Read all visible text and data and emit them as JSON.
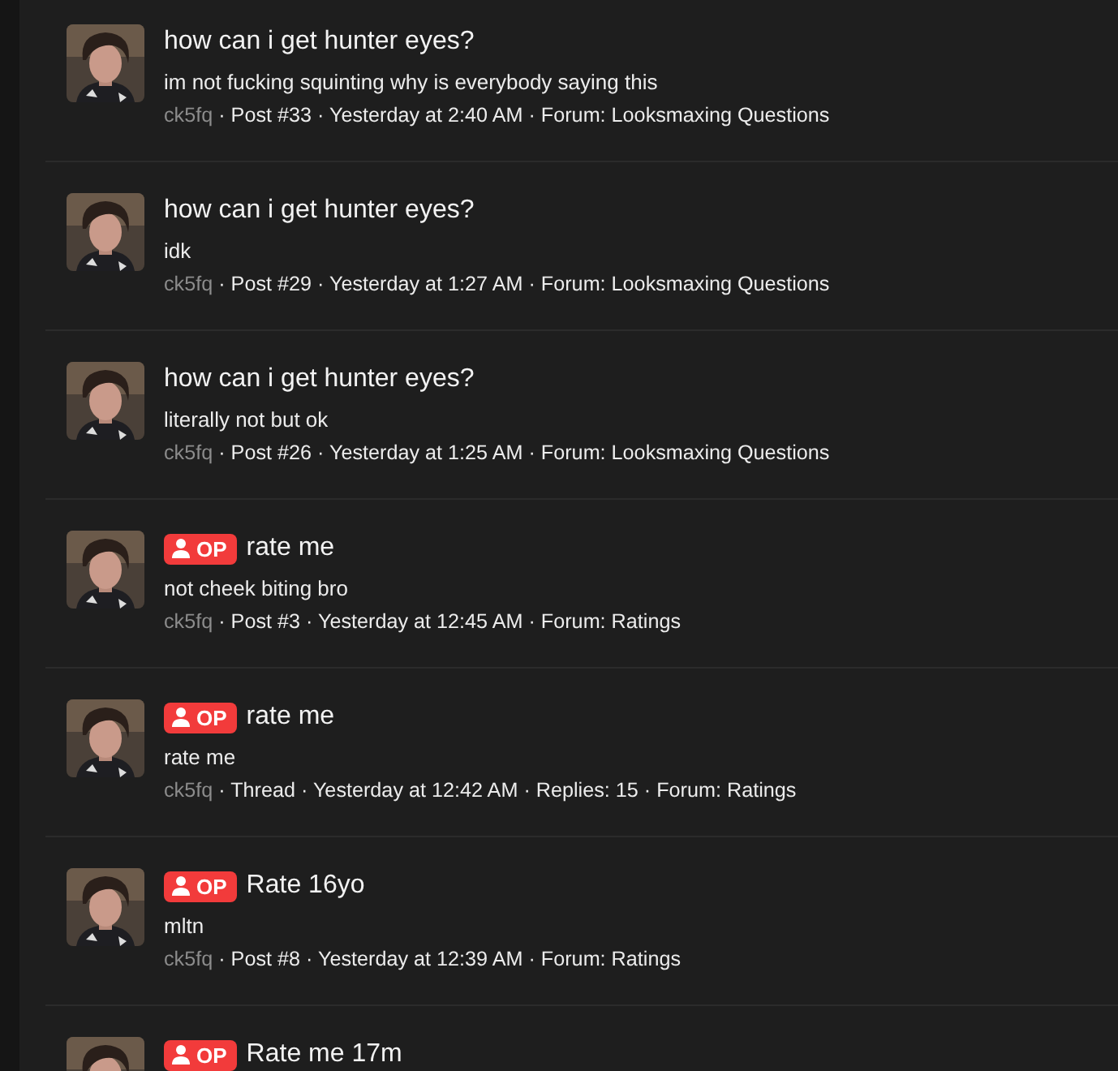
{
  "posts": [
    {
      "title": "how can i get hunter eyes?",
      "snippet": "im not fucking squinting why is everybody saying this",
      "username": "ck5fq",
      "details": "· Post #33 · Yesterday at 2:40 AM · Forum: Looksmaxing Questions"
    },
    {
      "title": "how can i get hunter eyes?",
      "snippet": "idk",
      "username": "ck5fq",
      "details": "· Post #29 · Yesterday at 1:27 AM · Forum: Looksmaxing Questions"
    },
    {
      "title": "how can i get hunter eyes?",
      "snippet": "literally not but ok",
      "username": "ck5fq",
      "details": "· Post #26 · Yesterday at 1:25 AM · Forum: Looksmaxing Questions"
    },
    {
      "op_badge": "OP",
      "title": "rate me",
      "snippet": "not cheek biting bro",
      "username": "ck5fq",
      "details": "· Post #3 · Yesterday at 12:45 AM · Forum: Ratings"
    },
    {
      "op_badge": "OP",
      "title": "rate me",
      "snippet": "rate me",
      "username": "ck5fq",
      "details": "· Thread · Yesterday at 12:42 AM · Replies: 15 · Forum: Ratings"
    },
    {
      "op_badge": "OP",
      "title": "Rate 16yo",
      "snippet": "mltn",
      "username": "ck5fq",
      "details": "· Post #8 · Yesterday at 12:39 AM · Forum: Ratings"
    },
    {
      "op_badge": "OP",
      "title": "Rate me 17m"
    }
  ]
}
